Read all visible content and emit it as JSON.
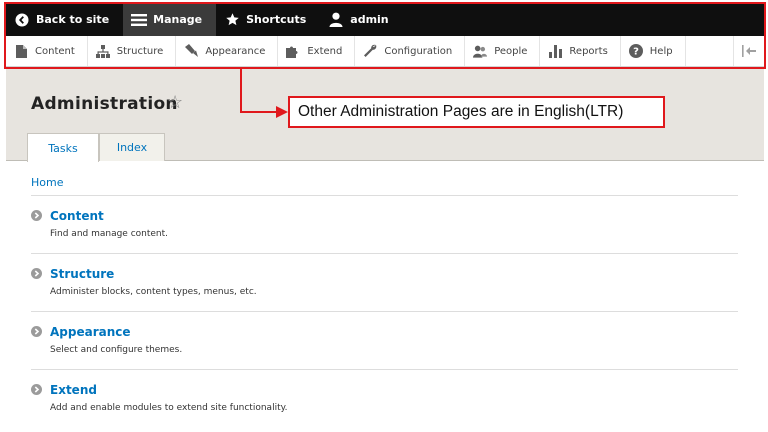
{
  "toolbar": {
    "back_label": "Back to site",
    "manage_label": "Manage",
    "shortcuts_label": "Shortcuts",
    "user_label": "admin"
  },
  "tray": {
    "content": "Content",
    "structure": "Structure",
    "appearance": "Appearance",
    "extend": "Extend",
    "configuration": "Configuration",
    "people": "People",
    "reports": "Reports",
    "help": "Help"
  },
  "page": {
    "title": "Administration",
    "tabs": [
      {
        "label": "Tasks",
        "active": true
      },
      {
        "label": "Index",
        "active": false
      }
    ],
    "breadcrumb": "Home"
  },
  "callout": {
    "text": "Other Administration Pages are in English(LTR)"
  },
  "items": [
    {
      "title": "Content",
      "description": "Find and manage content."
    },
    {
      "title": "Structure",
      "description": "Administer blocks, content types, menus, etc."
    },
    {
      "title": "Appearance",
      "description": "Select and configure themes."
    },
    {
      "title": "Extend",
      "description": "Add and enable modules to extend site functionality."
    }
  ],
  "colors": {
    "link": "#0074bd",
    "highlight": "#e0181c",
    "toolbar_bg": "#0f0f0f",
    "header_bg": "#e7e4df"
  }
}
